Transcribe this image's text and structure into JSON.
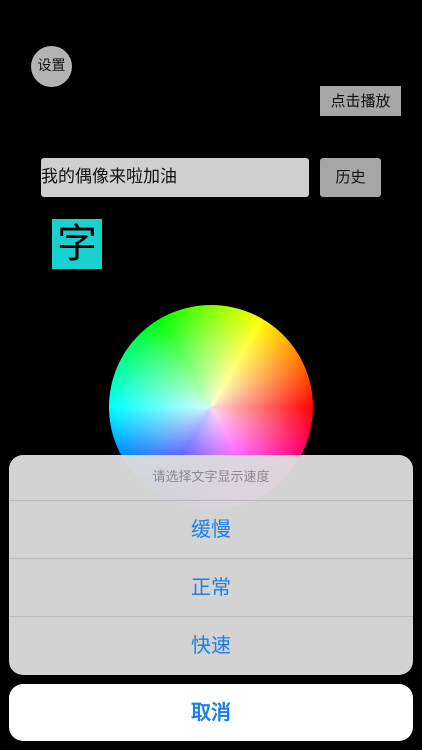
{
  "top": {
    "settings_label": "设置",
    "play_label": "点击播放"
  },
  "input": {
    "value": "我的偶像来啦加油",
    "history_label": "历史"
  },
  "preview": {
    "char": "字",
    "bg_color": "#19d1cf"
  },
  "action_sheet": {
    "title": "请选择文字显示速度",
    "options": [
      "缓慢",
      "正常",
      "快速"
    ],
    "cancel_label": "取消",
    "accent_color": "#1a7fe8"
  }
}
